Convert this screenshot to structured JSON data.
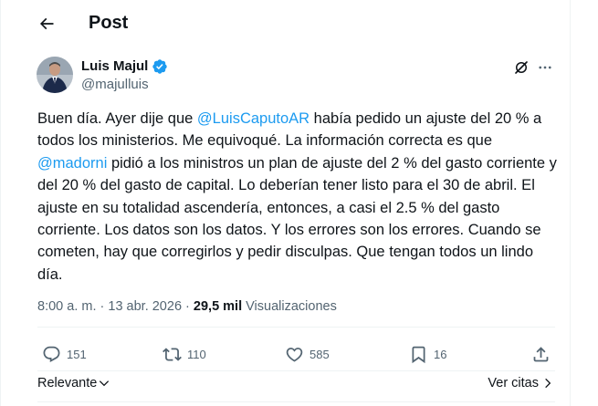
{
  "header": {
    "title": "Post",
    "back_icon": "arrow-left-icon"
  },
  "author": {
    "name": "Luis Majul",
    "handle": "@majulluis",
    "verified_color": "#1d9bf0"
  },
  "tweet": {
    "segments": [
      "Buen día. Ayer dije que ",
      "@LuisCaputoAR",
      " había pedido un ajuste del 20 % a todos los ministerios. Me equivoqué. La información correcta es que ",
      "@madorni",
      " pidió a los ministros un plan de ajuste del 2 % del gasto corriente y del 20 % del gasto de capital. Lo deberían tener listo para el 30 de abril. El ajuste en su totalidad ascendería, entonces, a casi el 2.5 % del gasto corriente. Los datos son los datos. Y los errores son los errores. Cuando se cometen, hay que corregirlos y pedir disculpas. Que tengan todos un lindo día."
    ]
  },
  "meta": {
    "time": "8:00 a. m.",
    "sep1": " · ",
    "date": "13 abr. 2026",
    "sep2": " · ",
    "views_count": "29,5 mil",
    "views_label": " Visualizaciones"
  },
  "actions": {
    "replies": "151",
    "reposts": "110",
    "likes": "585",
    "bookmarks": "16"
  },
  "footer": {
    "sort_label": "Relevante",
    "quotes_label": "Ver citas"
  },
  "colors": {
    "accent": "#1d9bf0",
    "muted": "#536471",
    "text": "#0f1419",
    "border": "#eff3f4"
  }
}
